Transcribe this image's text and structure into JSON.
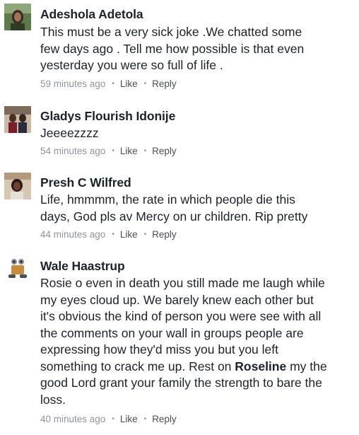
{
  "comments": [
    {
      "name": "Adeshola Adetola",
      "text": "This must be a very sick joke .We chatted some\nfew days ago . Tell me how possible is that even\nyesterday you were so full of life .",
      "time": "59 minutes ago",
      "like": "Like",
      "reply": "Reply"
    },
    {
      "name": "Gladys Flourish Idonije",
      "text": "Jeeeezzzz",
      "time": "54 minutes ago",
      "like": "Like",
      "reply": "Reply"
    },
    {
      "name": "Presh C Wilfred",
      "text": "Life, hmmmm, the rate in which people die this\ndays,  God pls av Mercy on ur children. Rip pretty",
      "time": "44 minutes ago",
      "like": "Like",
      "reply": "Reply"
    },
    {
      "name": "Wale Haastrup",
      "text_before": "Rosie o even in death you still made me laugh while\nmy eyes cloud up. We barely knew each other but\nit's obvious the kind of person you were see with all\nthe comments on your wall in groups people are\nexpressing how they'd miss you but you left\nsomething to crack me up. Rest on ",
      "mention": "Roseline",
      "text_after": " my the\ngood Lord grant your family the strength to bare the\nloss.",
      "time": "40 minutes ago",
      "like": "Like",
      "reply": "Reply"
    }
  ],
  "colors": {
    "text": "#1d2129",
    "meta": "#90949c",
    "action": "#4b4f56"
  }
}
